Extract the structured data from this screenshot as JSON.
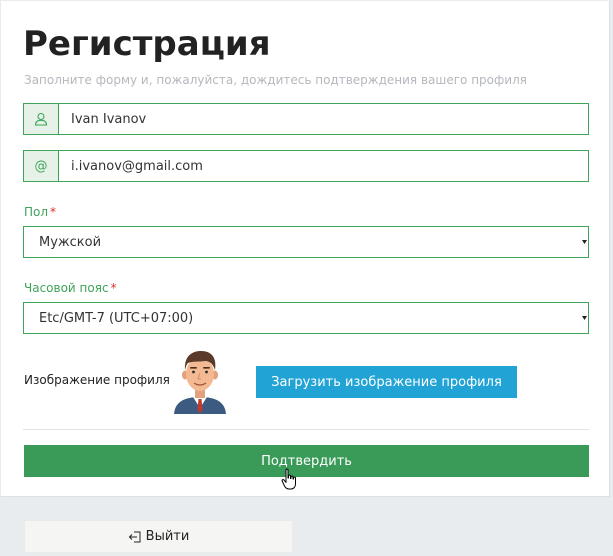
{
  "form": {
    "title": "Регистрация",
    "subtitle": "Заполните форму и, пожалуйста, дождитесь подтверждения вашего профиля",
    "name_value": "Ivan Ivanov",
    "email_value": "i.ivanov@gmail.com",
    "email_addon": "@",
    "gender_label": "Пол",
    "gender_value": "Мужской",
    "timezone_label": "Часовой пояс",
    "timezone_value": "Etc/GMT-7 (UTC+07:00)",
    "required_mark": "*",
    "profile_image_label": "Изображение профиля",
    "upload_button": "Загрузить изображение профиля",
    "submit_button": "Подтвердить"
  },
  "footer": {
    "logout_button": "Выйти"
  },
  "colors": {
    "accent_green": "#3fa35a",
    "submit_green": "#3a9b59",
    "upload_blue": "#21a3d6",
    "required_red": "#d9342b"
  },
  "icons": {
    "name_addon": "user-icon",
    "email_addon": "at-icon",
    "select_arrow": "caret-down-icon",
    "logout": "logout-icon",
    "cursor": "hand-pointer-icon"
  }
}
